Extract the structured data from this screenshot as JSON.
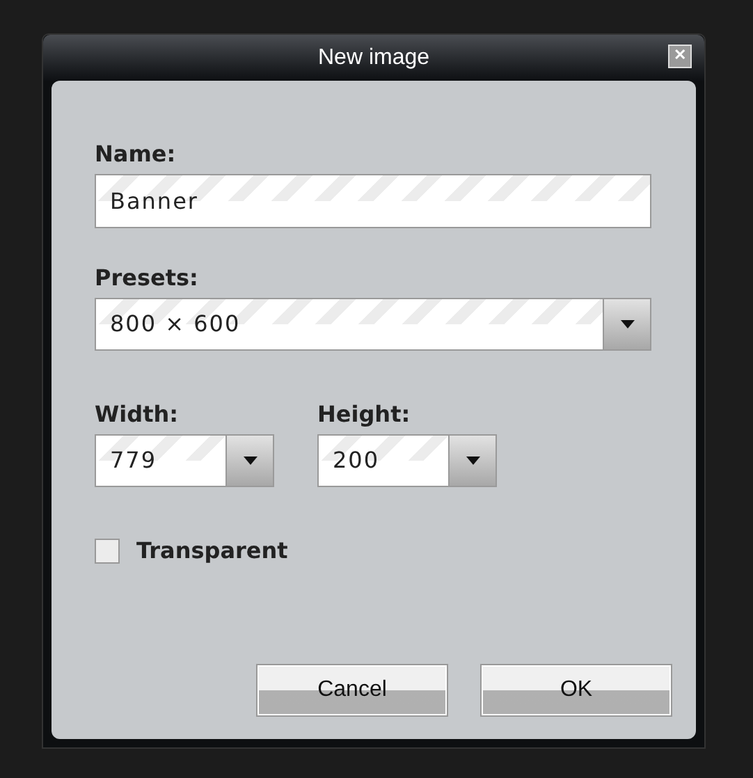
{
  "window": {
    "title": "New image",
    "close": "✕"
  },
  "name": {
    "label": "Name:",
    "value": "Banner"
  },
  "presets": {
    "label": "Presets:",
    "value": "800 × 600"
  },
  "width": {
    "label": "Width:",
    "value": "779"
  },
  "height": {
    "label": "Height:",
    "value": "200"
  },
  "transparent": {
    "label": "Transparent",
    "checked": false
  },
  "buttons": [
    "Cancel",
    "OK"
  ]
}
